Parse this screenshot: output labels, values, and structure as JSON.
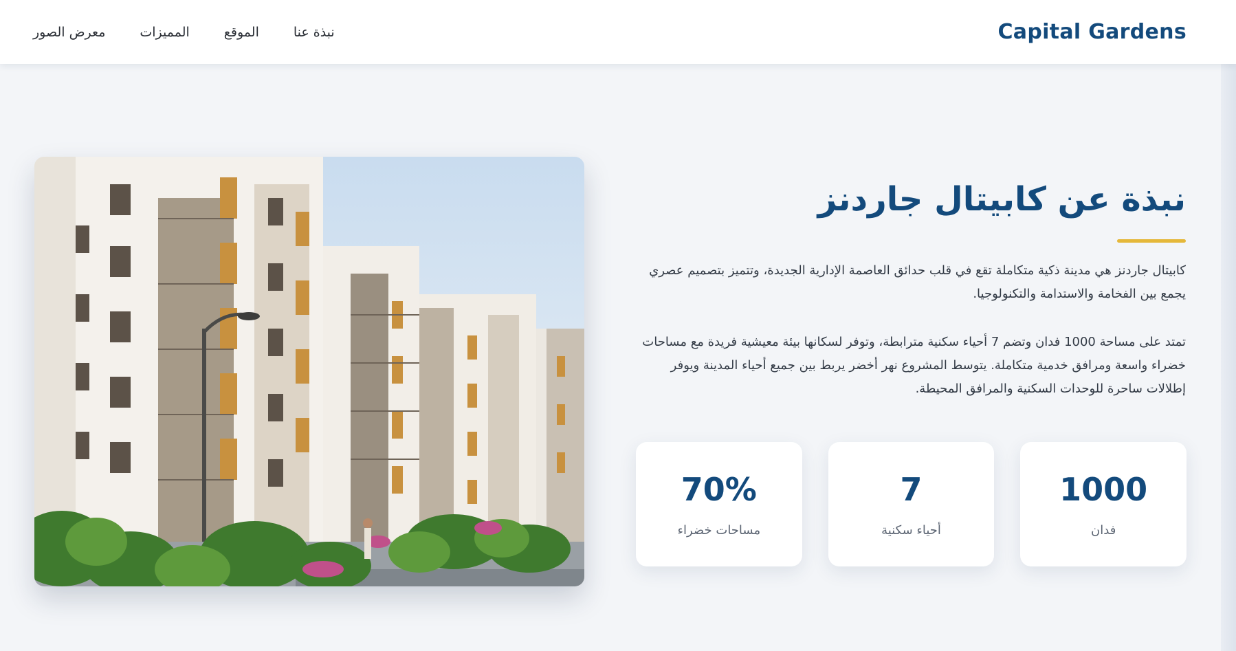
{
  "header": {
    "brand": "Capital Gardens",
    "nav": [
      {
        "label": "نبذة عنا"
      },
      {
        "label": "الموقع"
      },
      {
        "label": "المميزات"
      },
      {
        "label": "معرض الصور"
      }
    ]
  },
  "about": {
    "title": "نبذة عن كابيتال جاردنز",
    "paragraphs": [
      "كابيتال جاردنز هي مدينة ذكية متكاملة تقع في قلب حدائق العاصمة الإدارية الجديدة، وتتميز بتصميم عصري يجمع بين الفخامة والاستدامة والتكنولوجيا.",
      "تمتد على مساحة 1000 فدان وتضم 7 أحياء سكنية مترابطة، وتوفر لسكانها بيئة معيشية فريدة مع مساحات خضراء واسعة ومرافق خدمية متكاملة. يتوسط المشروع نهر أخضر يربط بين جميع أحياء المدينة ويوفر إطلالات ساحرة للوحدات السكنية والمرافق المحيطة."
    ],
    "stats": [
      {
        "value": "1000",
        "label": "فدان"
      },
      {
        "value": "7",
        "label": "أحياء سكنية"
      },
      {
        "value": "70%",
        "label": "مساحات خضراء"
      }
    ]
  },
  "colors": {
    "brand": "#134a7c",
    "accent": "#e5b83a",
    "background": "#f3f5f8"
  }
}
